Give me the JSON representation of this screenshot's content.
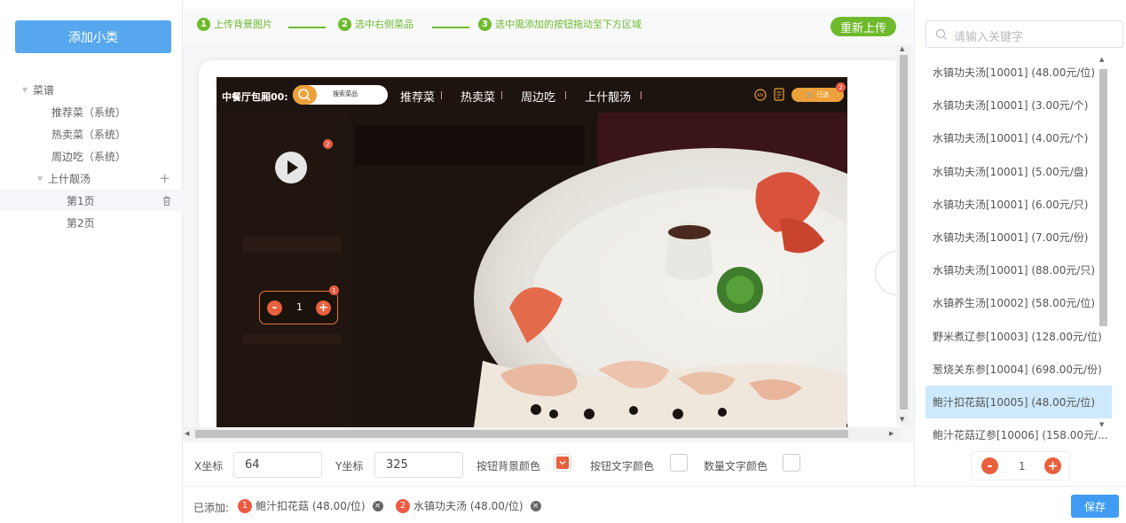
{
  "sidebar": {
    "add_button": "添加小类",
    "tree": [
      {
        "label": "菜谱",
        "level": 0,
        "caret": "▼"
      },
      {
        "label": "推荐菜（系统）",
        "level": 1
      },
      {
        "label": "热卖菜（系统）",
        "level": 1
      },
      {
        "label": "周边吃（系统）",
        "level": 1
      },
      {
        "label": "上什靓汤",
        "level": 1,
        "caret": "▼"
      },
      {
        "label": "第1页",
        "level": 2,
        "selected": true
      },
      {
        "label": "第2页",
        "level": 2
      }
    ],
    "plus_icon": "+"
  },
  "steps": {
    "items": [
      {
        "num": "1",
        "label": "上传背景图片"
      },
      {
        "num": "2",
        "label": "选中右侧菜品"
      },
      {
        "num": "3",
        "label": "选中需添加的按钮拖动至下方区域"
      }
    ],
    "reupload": "重新上传"
  },
  "preview": {
    "shop_name": "中餐厅包厢00:",
    "search_placeholder": "搜索菜品",
    "tabs": [
      "推荐菜",
      "热卖菜",
      "周边吃",
      "上什靓汤"
    ],
    "cart_label": "已选",
    "cart_count": "2",
    "play_badge": "2",
    "stepper_badge": "1",
    "stepper_value": "1",
    "stepper_minus": "-",
    "stepper_plus": "+"
  },
  "coords": {
    "x_label": "X坐标",
    "x_value": "64",
    "y_label": "Y坐标",
    "y_value": "325",
    "btn_bg_label": "按钮背景颜色",
    "btn_text_label": "按钮文字颜色",
    "qty_text_label": "数量文字颜色"
  },
  "added": {
    "label": "已添加:",
    "items": [
      {
        "num": "1",
        "label": "鲍汁扣花菇 (48.00/位)"
      },
      {
        "num": "2",
        "label": "水镇功夫汤 (48.00/位)"
      }
    ],
    "remove_icon": "×"
  },
  "save_button": "保存",
  "right": {
    "search_placeholder": "请输入关键字",
    "dishes": [
      "水镇功夫汤[10001] (48.00元/位)",
      "水镇功夫汤[10001] (3.00元/个)",
      "水镇功夫汤[10001] (4.00元/个)",
      "水镇功夫汤[10001] (5.00元/盘)",
      "水镇功夫汤[10001] (6.00元/只)",
      "水镇功夫汤[10001] (7.00元/份)",
      "水镇功夫汤[10001] (88.00元/只)",
      "水镇养生汤[10002] (58.00元/位)",
      "野米煮辽参[10003] (128.00元/位)",
      "葱烧关东参[10004] (698.00元/份)",
      "鲍汁扣花菇[10005] (48.00元/位)",
      "鲍汁花菇辽参[10006] (158.00元/..."
    ],
    "active_index": 10,
    "qty_value": "1",
    "qty_minus": "-",
    "qty_plus": "+"
  },
  "colors": {
    "primary": "#57a7ee",
    "step_green": "#6fba2c",
    "accent_red": "#e8603d",
    "save_blue": "#3f9cf2",
    "active_row": "#cde9fb"
  }
}
